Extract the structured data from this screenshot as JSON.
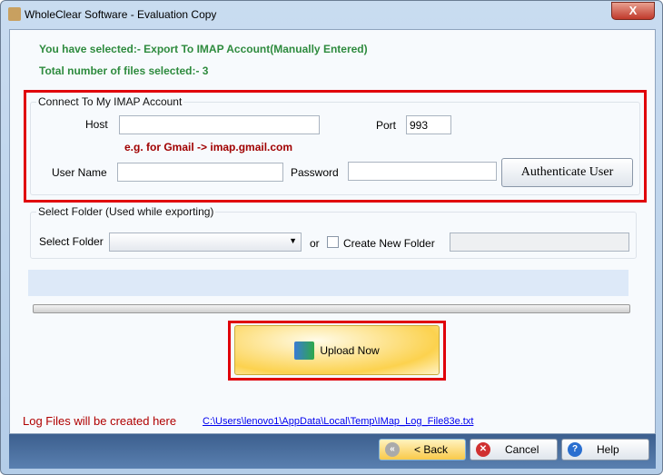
{
  "window": {
    "title": "WholeClear Software - Evaluation Copy",
    "close": "X"
  },
  "info": {
    "selected": "You have selected:- Export To IMAP Account(Manually Entered)",
    "count": "Total number of files selected:- 3"
  },
  "imap": {
    "legend": "Connect To My IMAP Account",
    "host_label": "Host",
    "host_value": "",
    "port_label": "Port",
    "port_value": "993",
    "example": "e.g. for Gmail -> imap.gmail.com",
    "user_label": "User Name",
    "user_value": "",
    "password_label": "Password",
    "password_value": "",
    "auth_button": "Authenticate User"
  },
  "folder": {
    "legend": "Select Folder (Used while exporting)",
    "select_label": "Select Folder",
    "selected": "",
    "or": "or",
    "create_label": "Create New Folder",
    "create_checked": false,
    "new_folder_value": ""
  },
  "progress": {
    "percent": 0
  },
  "upload_button": "Upload Now",
  "log": {
    "label": "Log Files will be created here",
    "path": "C:\\Users\\lenovo1\\AppData\\Local\\Temp\\IMap_Log_File83e.txt"
  },
  "footer": {
    "back": "< Back",
    "cancel": "Cancel",
    "help": "Help"
  },
  "colors": {
    "highlight": "#e0000a",
    "info": "#2e8b3e",
    "log": "#b00000"
  }
}
